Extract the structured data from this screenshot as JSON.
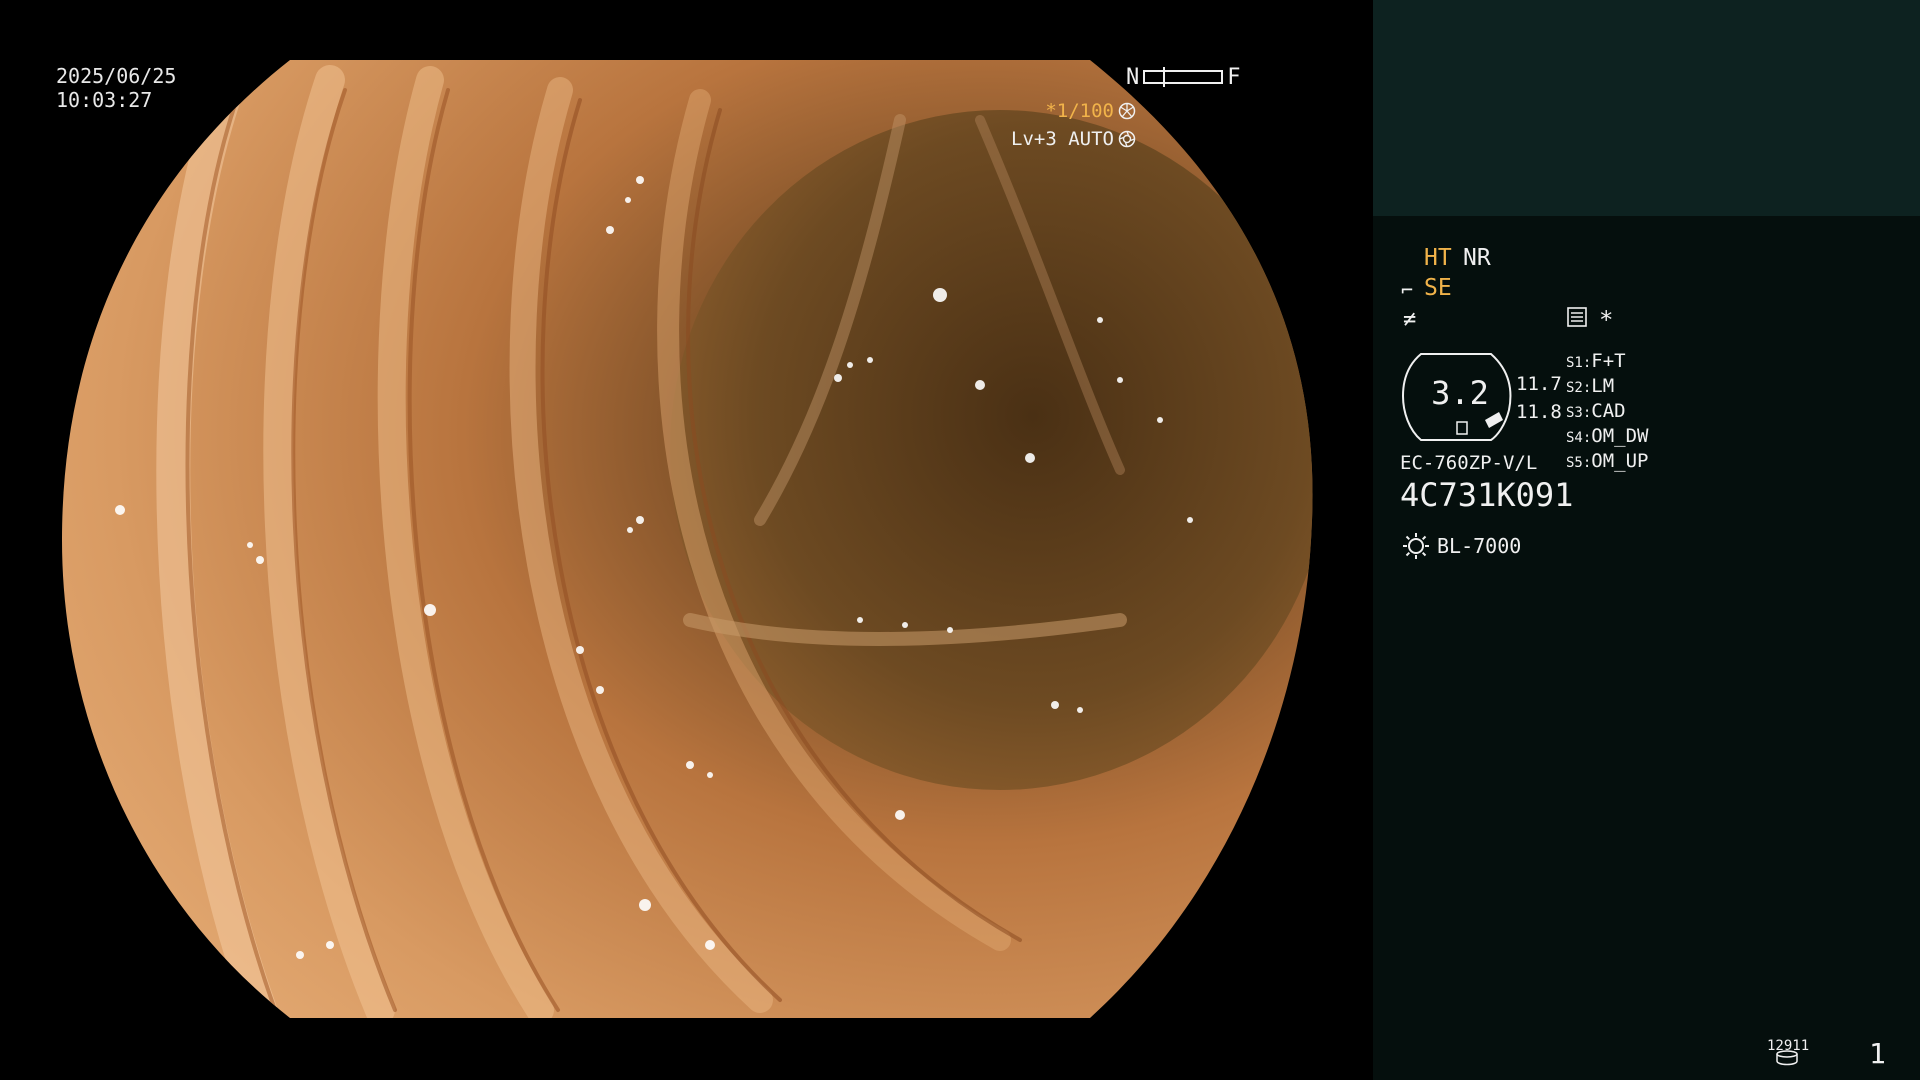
{
  "header": {
    "date": "2025/06/25",
    "time": "10:03:27"
  },
  "overlay": {
    "nf_near": "N",
    "nf_far": "F",
    "shutter_speed": "*1/100",
    "enhancement": "Lv+3 AUTO"
  },
  "panel": {
    "ht": "HT",
    "nr": "NR",
    "se": "SE",
    "star": "*",
    "badge_value": "3.2",
    "zoom_values": [
      "11.7",
      "11.8"
    ],
    "switches": [
      {
        "key": "S1:",
        "value": "F+T"
      },
      {
        "key": "S2:",
        "value": "LM"
      },
      {
        "key": "S3:",
        "value": "CAD"
      },
      {
        "key": "S4:",
        "value": "OM_DW"
      },
      {
        "key": "S5:",
        "value": "OM_UP"
      }
    ],
    "scope_model": "EC-760ZP-V/L",
    "scope_serial": "4C731K091",
    "light_source": "BL-7000",
    "storage_count": "12911",
    "page_number": "1"
  },
  "icons": {
    "structure_enhance": "se-hook-icon",
    "colour": "colour-mode-icon",
    "memo": "memo-list-icon",
    "shutter": "shutter-icon",
    "auto_iris": "iris-icon",
    "lamp": "lamp-icon",
    "disk": "disk-icon"
  },
  "colors": {
    "accent": "#f1b34a",
    "text": "#f0f0f0",
    "panel_bg": "#050f0d",
    "panel_top": "#0d2220"
  }
}
